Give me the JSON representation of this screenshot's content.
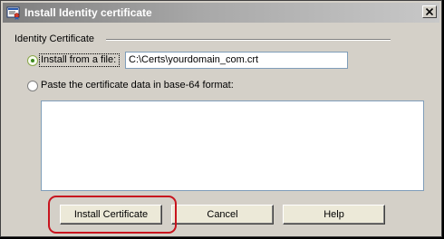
{
  "window": {
    "title": "Install Identity certificate",
    "icon": "certificate-app-icon",
    "close_icon": "close-icon"
  },
  "group": {
    "label": "Identity Certificate"
  },
  "options": {
    "from_file": {
      "label": "Install from a file:",
      "selected": true,
      "path_value": "C:\\Certs\\yourdomain_com.crt"
    },
    "paste": {
      "label": "Paste the certificate data in base-64 format:",
      "selected": false,
      "text_value": ""
    }
  },
  "buttons": {
    "install": "Install Certificate",
    "cancel": "Cancel",
    "help": "Help"
  },
  "colors": {
    "highlight": "#c8141e",
    "selected_radio": "#3c8a1e"
  }
}
